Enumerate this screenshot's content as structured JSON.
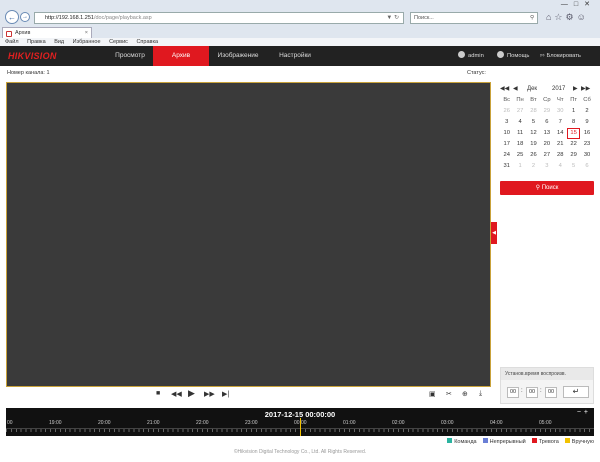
{
  "browser": {
    "url_host": "http://192.168.1.251",
    "url_path": "/doc/page/playback.asp",
    "search_placeholder": "Поиск...",
    "tab_title": "Архив",
    "menu": [
      "Файл",
      "Правка",
      "Вид",
      "Избранное",
      "Сервис",
      "Справка"
    ]
  },
  "app": {
    "logo": "HIKVISION",
    "tabs": [
      "Просмотр",
      "Архив",
      "Изображение",
      "Настройки"
    ],
    "user": "admin",
    "help": "Помощь",
    "lock": "Блокировать",
    "channel_label": "Номер канала: 1",
    "status_label": "Статус:"
  },
  "calendar": {
    "month": "Дек",
    "year": "2017",
    "weekdays": [
      "Вс",
      "Пн",
      "Вт",
      "Ср",
      "Чт",
      "Пт",
      "Сб"
    ],
    "days": [
      [
        "26",
        "27",
        "28",
        "29",
        "30",
        "1",
        "2"
      ],
      [
        "3",
        "4",
        "5",
        "6",
        "7",
        "8",
        "9"
      ],
      [
        "10",
        "11",
        "12",
        "13",
        "14",
        "15",
        "16"
      ],
      [
        "17",
        "18",
        "19",
        "20",
        "21",
        "22",
        "23"
      ],
      [
        "24",
        "25",
        "26",
        "27",
        "28",
        "29",
        "30"
      ],
      [
        "31",
        "1",
        "2",
        "3",
        "4",
        "5",
        "6"
      ]
    ],
    "search_label": "Поиск"
  },
  "playback_time": {
    "title": "Установ.время воспроизв.",
    "h": "00",
    "m": "00",
    "s": "00"
  },
  "timeline": {
    "current": "2017-12-15 00:00:00",
    "labels": [
      "00",
      "19:00",
      "20:00",
      "21:00",
      "22:00",
      "23:00",
      "00:00",
      "01:00",
      "02:00",
      "03:00",
      "04:00",
      "05:00"
    ]
  },
  "legend": [
    {
      "label": "Команда",
      "color": "#2bb3a0"
    },
    {
      "label": "Непрерывный",
      "color": "#6a7fd6"
    },
    {
      "label": "Тревога",
      "color": "#e0181f"
    },
    {
      "label": "Вручную",
      "color": "#f2c200"
    }
  ],
  "footer": "©Hikvision Digital Technology Co., Ltd. All Rights Reserved."
}
